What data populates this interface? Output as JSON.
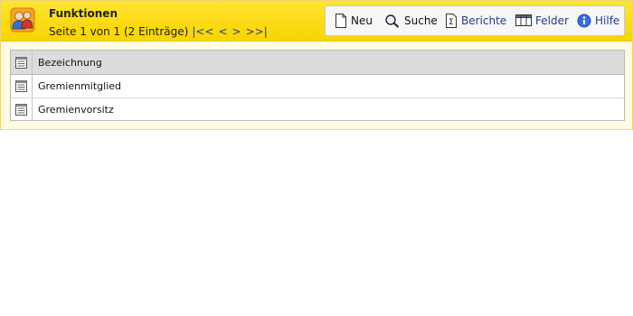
{
  "header": {
    "title": "Funktionen",
    "pager_text": "Seite 1 von 1 (2 Einträge)",
    "nav_first": "|<<",
    "nav_prev": "<",
    "nav_next": ">",
    "nav_last": ">>|"
  },
  "toolbar": {
    "new_label": "Neu",
    "search_label": "Suche",
    "reports_label": "Berichte",
    "fields_label": "Felder",
    "help_label": "Hilfe"
  },
  "table": {
    "columns": [
      "Bezeichnung"
    ],
    "rows": [
      {
        "bezeichnung": "Gremienmitglied"
      },
      {
        "bezeichnung": "Gremienvorsitz"
      }
    ]
  },
  "colors": {
    "header_bg": "#f8d400",
    "link_blue": "#2a3a8a",
    "frame_bg": "#fffbe2"
  }
}
